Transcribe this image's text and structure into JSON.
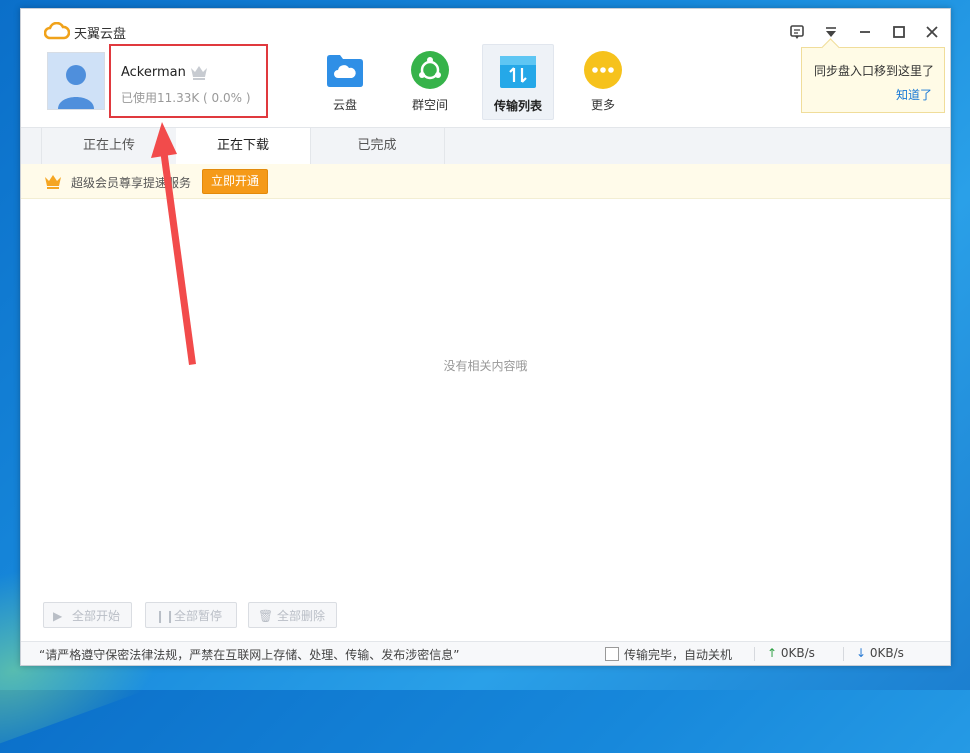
{
  "app": {
    "title": "天翼云盘"
  },
  "user": {
    "name": "Ackerman",
    "usage": "已使用11.33K ( 0.0% )"
  },
  "nav": [
    {
      "label": "云盘",
      "icon": "cloud-folder-icon",
      "color": "#2f8fe6"
    },
    {
      "label": "群空间",
      "icon": "group-space-icon",
      "color": "#36b34a"
    },
    {
      "label": "传输列表",
      "icon": "transfer-list-icon",
      "color": "#25a8e8",
      "active": true
    },
    {
      "label": "更多",
      "icon": "more-icon",
      "color": "#f6c21c"
    }
  ],
  "tooltip": {
    "text": "同步盘入口移到这里了",
    "link": "知道了"
  },
  "tabs": [
    {
      "label": "正在上传"
    },
    {
      "label": "正在下载",
      "active": true
    },
    {
      "label": "已完成"
    }
  ],
  "vip_bar": {
    "text": "超级会员尊享提速服务",
    "button": "立即开通"
  },
  "empty_text": "没有相关内容哦",
  "actions": [
    {
      "label": "全部开始",
      "icon": "play-icon"
    },
    {
      "label": "全部暂停",
      "icon": "pause-icon"
    },
    {
      "label": "全部删除",
      "icon": "trash-icon"
    }
  ],
  "status": {
    "notice": "“请严格遵守保密法律法规，严禁在互联网上存储、处理、传输、发布涉密信息”",
    "auto_shutdown": "传输完毕，自动关机",
    "upload_speed": "0KB/s",
    "download_speed": "0KB/s"
  },
  "colors": {
    "accent": "#1778d6",
    "highlight_border": "#e0393e",
    "annotation_arrow": "#f24b4b",
    "vip_button": "#f59a19"
  }
}
